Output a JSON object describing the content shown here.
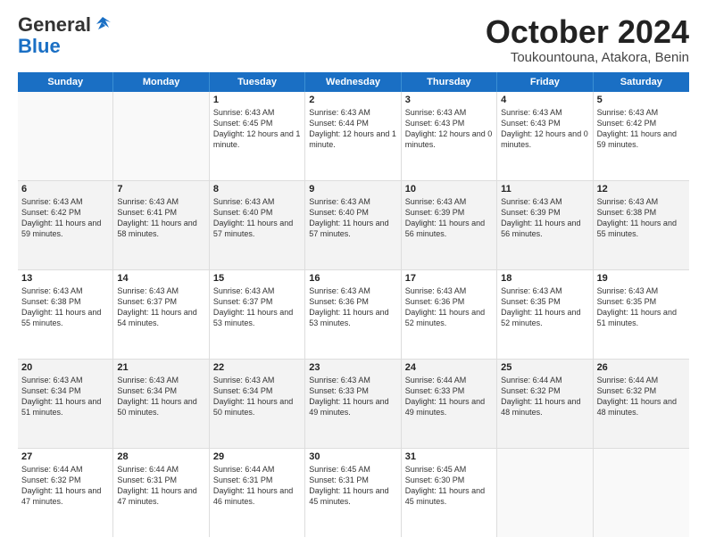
{
  "header": {
    "logo_general": "General",
    "logo_blue": "Blue",
    "title": "October 2024",
    "subtitle": "Toukountouna, Atakora, Benin"
  },
  "days_of_week": [
    "Sunday",
    "Monday",
    "Tuesday",
    "Wednesday",
    "Thursday",
    "Friday",
    "Saturday"
  ],
  "weeks": [
    [
      {
        "day": "",
        "sunrise": "",
        "sunset": "",
        "daylight": "",
        "empty": true
      },
      {
        "day": "",
        "sunrise": "",
        "sunset": "",
        "daylight": "",
        "empty": true
      },
      {
        "day": "1",
        "sunrise": "Sunrise: 6:43 AM",
        "sunset": "Sunset: 6:45 PM",
        "daylight": "Daylight: 12 hours and 1 minute."
      },
      {
        "day": "2",
        "sunrise": "Sunrise: 6:43 AM",
        "sunset": "Sunset: 6:44 PM",
        "daylight": "Daylight: 12 hours and 1 minute."
      },
      {
        "day": "3",
        "sunrise": "Sunrise: 6:43 AM",
        "sunset": "Sunset: 6:43 PM",
        "daylight": "Daylight: 12 hours and 0 minutes."
      },
      {
        "day": "4",
        "sunrise": "Sunrise: 6:43 AM",
        "sunset": "Sunset: 6:43 PM",
        "daylight": "Daylight: 12 hours and 0 minutes."
      },
      {
        "day": "5",
        "sunrise": "Sunrise: 6:43 AM",
        "sunset": "Sunset: 6:42 PM",
        "daylight": "Daylight: 11 hours and 59 minutes."
      }
    ],
    [
      {
        "day": "6",
        "sunrise": "Sunrise: 6:43 AM",
        "sunset": "Sunset: 6:42 PM",
        "daylight": "Daylight: 11 hours and 59 minutes."
      },
      {
        "day": "7",
        "sunrise": "Sunrise: 6:43 AM",
        "sunset": "Sunset: 6:41 PM",
        "daylight": "Daylight: 11 hours and 58 minutes."
      },
      {
        "day": "8",
        "sunrise": "Sunrise: 6:43 AM",
        "sunset": "Sunset: 6:40 PM",
        "daylight": "Daylight: 11 hours and 57 minutes."
      },
      {
        "day": "9",
        "sunrise": "Sunrise: 6:43 AM",
        "sunset": "Sunset: 6:40 PM",
        "daylight": "Daylight: 11 hours and 57 minutes."
      },
      {
        "day": "10",
        "sunrise": "Sunrise: 6:43 AM",
        "sunset": "Sunset: 6:39 PM",
        "daylight": "Daylight: 11 hours and 56 minutes."
      },
      {
        "day": "11",
        "sunrise": "Sunrise: 6:43 AM",
        "sunset": "Sunset: 6:39 PM",
        "daylight": "Daylight: 11 hours and 56 minutes."
      },
      {
        "day": "12",
        "sunrise": "Sunrise: 6:43 AM",
        "sunset": "Sunset: 6:38 PM",
        "daylight": "Daylight: 11 hours and 55 minutes."
      }
    ],
    [
      {
        "day": "13",
        "sunrise": "Sunrise: 6:43 AM",
        "sunset": "Sunset: 6:38 PM",
        "daylight": "Daylight: 11 hours and 55 minutes."
      },
      {
        "day": "14",
        "sunrise": "Sunrise: 6:43 AM",
        "sunset": "Sunset: 6:37 PM",
        "daylight": "Daylight: 11 hours and 54 minutes."
      },
      {
        "day": "15",
        "sunrise": "Sunrise: 6:43 AM",
        "sunset": "Sunset: 6:37 PM",
        "daylight": "Daylight: 11 hours and 53 minutes."
      },
      {
        "day": "16",
        "sunrise": "Sunrise: 6:43 AM",
        "sunset": "Sunset: 6:36 PM",
        "daylight": "Daylight: 11 hours and 53 minutes."
      },
      {
        "day": "17",
        "sunrise": "Sunrise: 6:43 AM",
        "sunset": "Sunset: 6:36 PM",
        "daylight": "Daylight: 11 hours and 52 minutes."
      },
      {
        "day": "18",
        "sunrise": "Sunrise: 6:43 AM",
        "sunset": "Sunset: 6:35 PM",
        "daylight": "Daylight: 11 hours and 52 minutes."
      },
      {
        "day": "19",
        "sunrise": "Sunrise: 6:43 AM",
        "sunset": "Sunset: 6:35 PM",
        "daylight": "Daylight: 11 hours and 51 minutes."
      }
    ],
    [
      {
        "day": "20",
        "sunrise": "Sunrise: 6:43 AM",
        "sunset": "Sunset: 6:34 PM",
        "daylight": "Daylight: 11 hours and 51 minutes."
      },
      {
        "day": "21",
        "sunrise": "Sunrise: 6:43 AM",
        "sunset": "Sunset: 6:34 PM",
        "daylight": "Daylight: 11 hours and 50 minutes."
      },
      {
        "day": "22",
        "sunrise": "Sunrise: 6:43 AM",
        "sunset": "Sunset: 6:34 PM",
        "daylight": "Daylight: 11 hours and 50 minutes."
      },
      {
        "day": "23",
        "sunrise": "Sunrise: 6:43 AM",
        "sunset": "Sunset: 6:33 PM",
        "daylight": "Daylight: 11 hours and 49 minutes."
      },
      {
        "day": "24",
        "sunrise": "Sunrise: 6:44 AM",
        "sunset": "Sunset: 6:33 PM",
        "daylight": "Daylight: 11 hours and 49 minutes."
      },
      {
        "day": "25",
        "sunrise": "Sunrise: 6:44 AM",
        "sunset": "Sunset: 6:32 PM",
        "daylight": "Daylight: 11 hours and 48 minutes."
      },
      {
        "day": "26",
        "sunrise": "Sunrise: 6:44 AM",
        "sunset": "Sunset: 6:32 PM",
        "daylight": "Daylight: 11 hours and 48 minutes."
      }
    ],
    [
      {
        "day": "27",
        "sunrise": "Sunrise: 6:44 AM",
        "sunset": "Sunset: 6:32 PM",
        "daylight": "Daylight: 11 hours and 47 minutes."
      },
      {
        "day": "28",
        "sunrise": "Sunrise: 6:44 AM",
        "sunset": "Sunset: 6:31 PM",
        "daylight": "Daylight: 11 hours and 47 minutes."
      },
      {
        "day": "29",
        "sunrise": "Sunrise: 6:44 AM",
        "sunset": "Sunset: 6:31 PM",
        "daylight": "Daylight: 11 hours and 46 minutes."
      },
      {
        "day": "30",
        "sunrise": "Sunrise: 6:45 AM",
        "sunset": "Sunset: 6:31 PM",
        "daylight": "Daylight: 11 hours and 45 minutes."
      },
      {
        "day": "31",
        "sunrise": "Sunrise: 6:45 AM",
        "sunset": "Sunset: 6:30 PM",
        "daylight": "Daylight: 11 hours and 45 minutes."
      },
      {
        "day": "",
        "sunrise": "",
        "sunset": "",
        "daylight": "",
        "empty": true
      },
      {
        "day": "",
        "sunrise": "",
        "sunset": "",
        "daylight": "",
        "empty": true
      }
    ]
  ]
}
